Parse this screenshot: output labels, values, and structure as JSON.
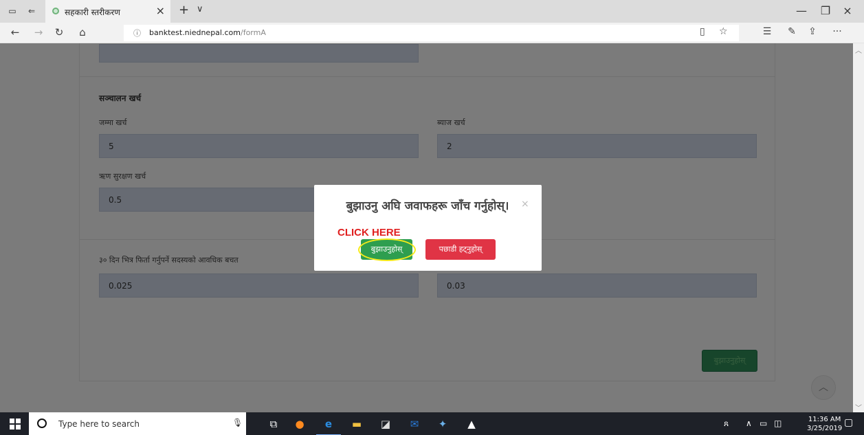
{
  "browser": {
    "tab_title": "सहकारी स्तरीकरण",
    "tab_close": "×",
    "new_tab": "+",
    "tab_menu": "∨",
    "url_info_icon": "info-icon",
    "url_domain": "banktest.niednepal.com",
    "url_path": "/formA",
    "window_minimize": "—",
    "window_restore": "❐",
    "window_close": "×"
  },
  "form": {
    "operating_expense_title": "सञ्चालन खर्च",
    "total_expense_label": "जम्मा खर्च",
    "total_expense_value": "5",
    "interest_expense_label": "ब्याज खर्च",
    "interest_expense_value": "2",
    "loan_protection_label": "ऋण सुरक्षण खर्च",
    "loan_protection_value": "0.5",
    "refund_savings_label": "३० दिन भित्र फिर्ता गर्नुपर्ने सदस्यको आवधिक बचत",
    "refund_savings_value": "0.025",
    "right_value": "0.03",
    "submit_label": "बुझाउनुहोस्"
  },
  "modal": {
    "title": "बुझाउनु अघि जवाफहरू जाँच गर्नुहोस्।",
    "close": "×",
    "confirm_label": "बुझाउनुहोस्",
    "cancel_label": "पछाडी हट्नुहोस्",
    "annotation": "CLICK HERE"
  },
  "taskbar": {
    "search_placeholder": "Type here to search",
    "time": "11:36 AM",
    "date": "3/25/2019"
  },
  "colors": {
    "confirm": "#2e9e4f",
    "cancel": "#e03445",
    "field_bg": "#ced7e6",
    "annotation": "#e02020",
    "highlight": "#f5ea1a"
  }
}
